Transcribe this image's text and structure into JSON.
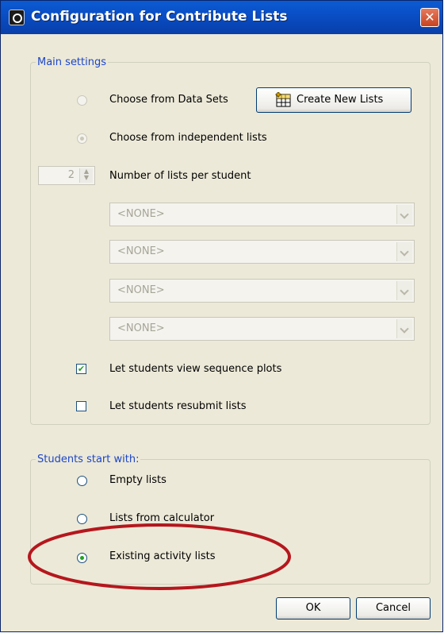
{
  "window": {
    "title": "Configuration for Contribute Lists",
    "close_glyph": "✕",
    "app_icon": "ti-circle-icon"
  },
  "main_settings": {
    "legend": "Main settings",
    "choose_from_data_sets": {
      "label": "Choose from Data Sets",
      "selected": false,
      "enabled": false
    },
    "create_new_lists_button": "Create New Lists",
    "choose_from_independent_lists": {
      "label": "Choose from independent lists",
      "selected": true,
      "enabled": false
    },
    "lists_per_student": {
      "value": "2",
      "label": "Number of lists per student"
    },
    "list_selectors": [
      "<NONE>",
      "<NONE>",
      "<NONE>",
      "<NONE>"
    ],
    "view_sequence_plots": {
      "label": "Let students view sequence plots",
      "checked": true
    },
    "resubmit_lists": {
      "label": "Let students resubmit lists",
      "checked": false
    }
  },
  "students_start_with": {
    "legend": "Students start with:",
    "options": [
      {
        "label": "Empty lists",
        "selected": false
      },
      {
        "label": "Lists from calculator",
        "selected": false
      },
      {
        "label": "Existing activity lists",
        "selected": true
      }
    ]
  },
  "buttons": {
    "ok": "OK",
    "cancel": "Cancel"
  },
  "colors": {
    "title_bar": "#0a4fc6",
    "legend_text": "#1c46c8",
    "annotation_ellipse": "#b5171d"
  }
}
